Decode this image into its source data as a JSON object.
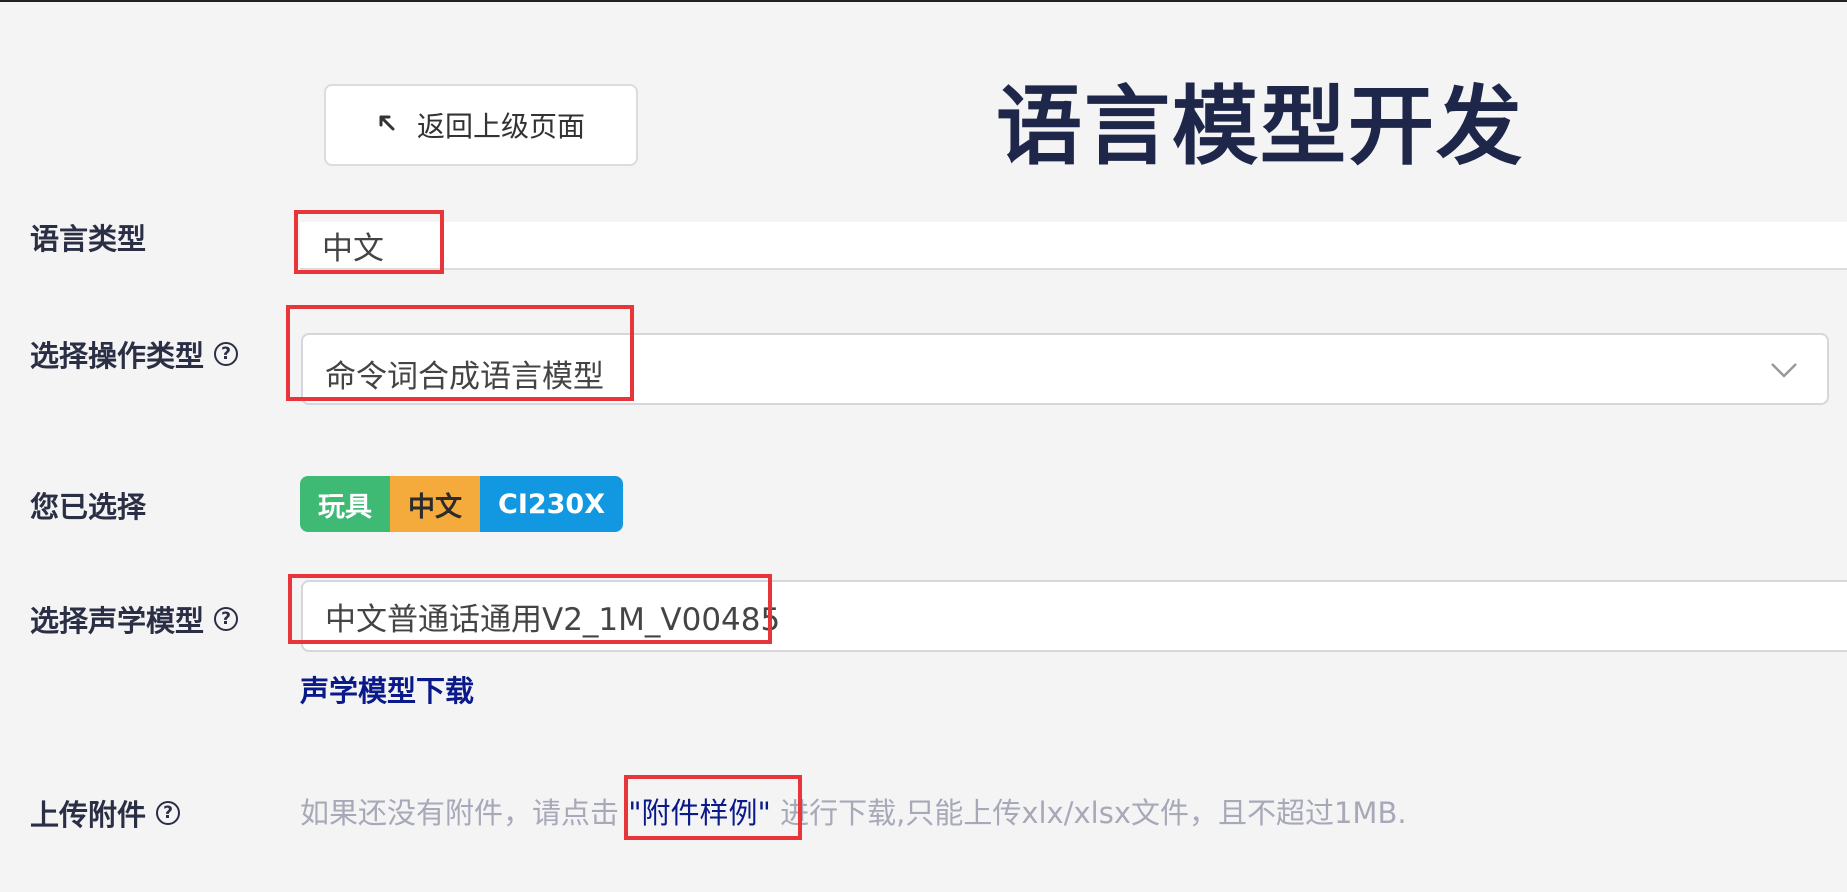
{
  "back_button": {
    "label": "返回上级页面",
    "icon": "arrow-up-left-icon"
  },
  "page_title": "语言模型开发",
  "language_type": {
    "label": "语言类型",
    "value": "中文"
  },
  "operation_type": {
    "label": "选择操作类型",
    "help_icon": "question-circle-icon",
    "value": "命令词合成语言模型",
    "dropdown_icon": "chevron-down-icon"
  },
  "selected": {
    "label": "您已选择",
    "tags": [
      {
        "text": "玩具",
        "color": "#3fba75"
      },
      {
        "text": "中文",
        "color": "#f5ab3c"
      },
      {
        "text": "CI230X",
        "color": "#1198e0"
      }
    ]
  },
  "acoustic_model": {
    "label": "选择声学模型",
    "help_icon": "question-circle-icon",
    "value": "中文普通话通用V2_1M_V00485",
    "download_link": "声学模型下载"
  },
  "upload": {
    "label": "上传附件",
    "help_icon": "question-circle-icon",
    "hint_before": "如果还没有附件，请点击 ",
    "sample_link": "\"附件样例\"",
    "hint_after": " 进行下载,只能上传xlx/xlsx文件，且不超过1MB."
  },
  "colors": {
    "title": "#1e2749",
    "highlight": "#e8353a",
    "link": "#0b1a8a"
  }
}
